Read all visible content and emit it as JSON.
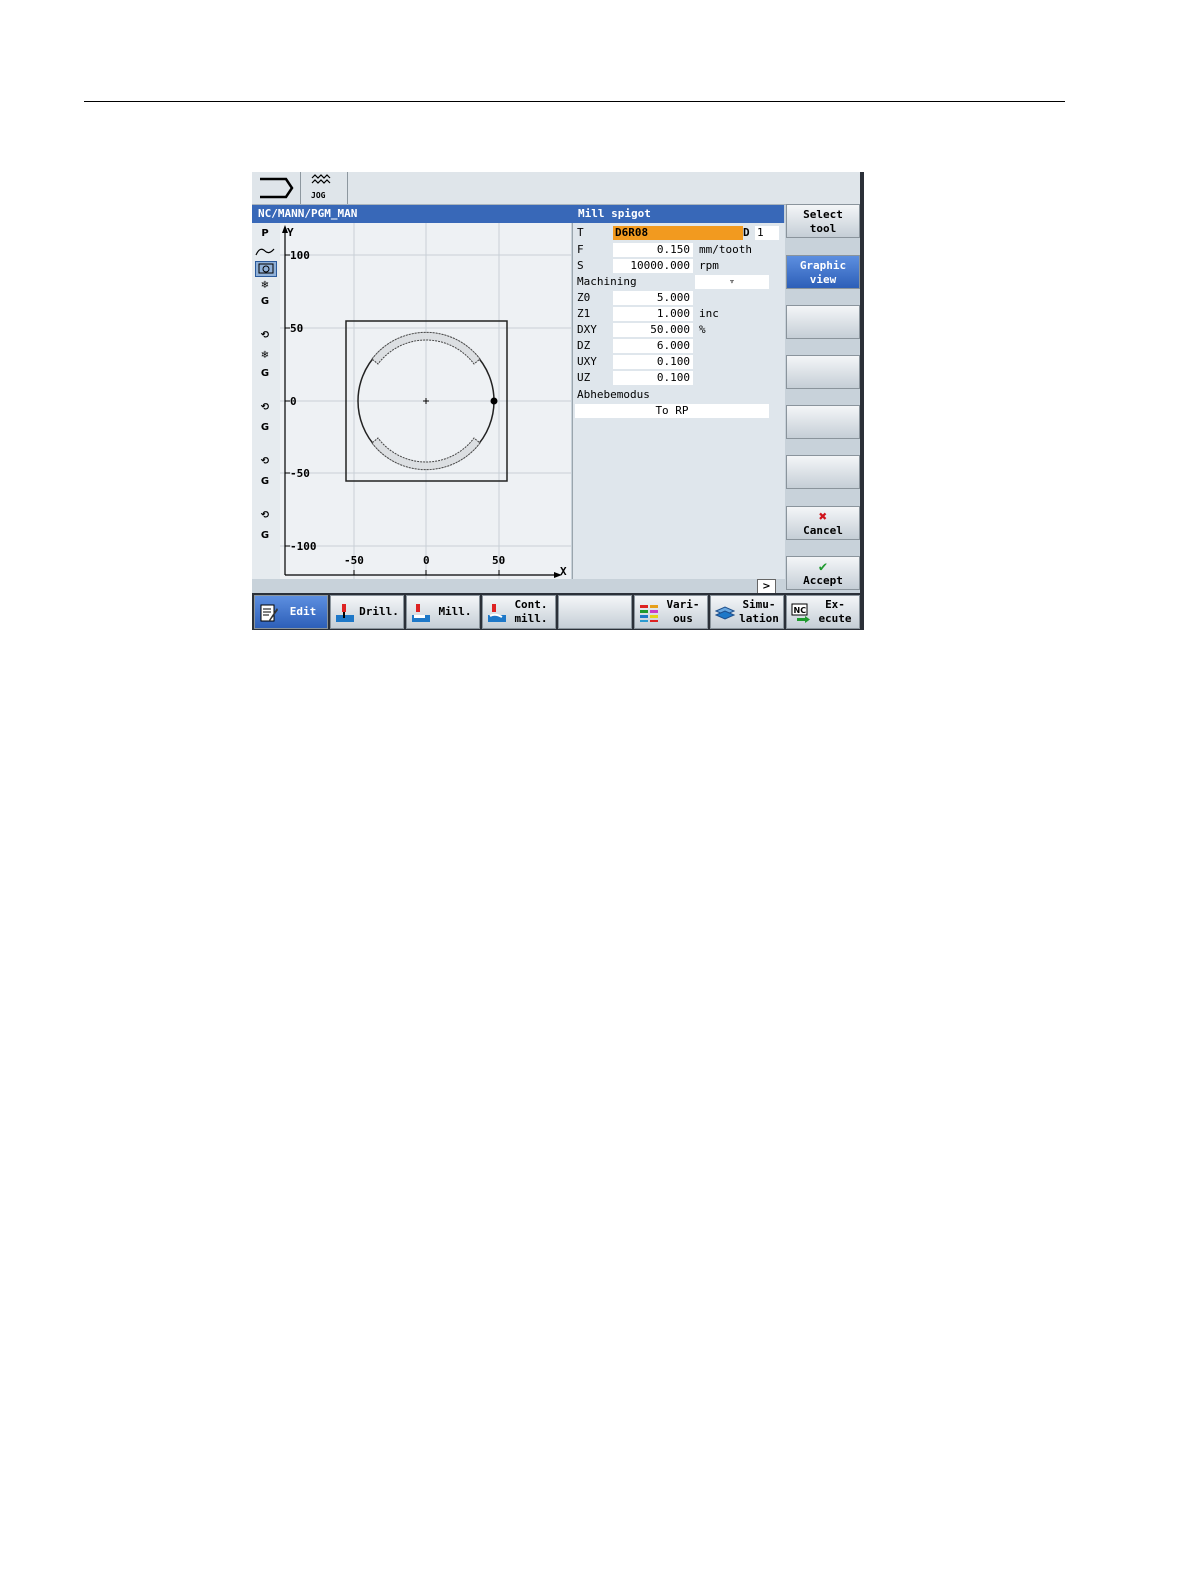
{
  "topbar": {
    "mode": "JOG"
  },
  "header": {
    "path": "NC/MANN/PGM_MAN",
    "cycle_title": "Mill spigot"
  },
  "left_icons": [
    "P",
    "G",
    "G",
    "G",
    "G",
    "G"
  ],
  "graph": {
    "y_axis_label": "Y",
    "x_axis_label": "X",
    "y_ticks": [
      "100",
      "50",
      "0",
      "-50",
      "-100"
    ],
    "x_ticks": [
      "-50",
      "0",
      "50"
    ]
  },
  "params": {
    "T": {
      "label": "T",
      "value": "D6R08",
      "d_label": "D",
      "d_value": "1"
    },
    "rows": [
      {
        "label": "F",
        "value": "0.150",
        "unit": "mm/tooth"
      },
      {
        "label": "S",
        "value": "10000.000",
        "unit": "rpm"
      }
    ],
    "machining": {
      "label": "Machining",
      "value": "▿"
    },
    "rows2": [
      {
        "label": "Z0",
        "value": "5.000",
        "unit": ""
      },
      {
        "label": "Z1",
        "value": "1.000",
        "unit": "inc"
      },
      {
        "label": "DXY",
        "value": "50.000",
        "unit": "%"
      },
      {
        "label": "DZ",
        "value": "6.000",
        "unit": ""
      },
      {
        "label": "UXY",
        "value": "0.100",
        "unit": ""
      },
      {
        "label": "UZ",
        "value": "0.100",
        "unit": ""
      }
    ],
    "retract": {
      "label": "Abhebemodus",
      "value": "To RP"
    },
    "more": ">"
  },
  "vertical_softkeys": [
    {
      "label": "Select\ntool"
    },
    {
      "label": "Graphic\nview"
    },
    {
      "label": ""
    },
    {
      "label": ""
    },
    {
      "label": ""
    },
    {
      "label": ""
    },
    {
      "label": "Cancel"
    },
    {
      "label": "Accept"
    }
  ],
  "bottom_softkeys": [
    {
      "label": "Edit"
    },
    {
      "label": "Drill."
    },
    {
      "label": "Mill."
    },
    {
      "label": "Cont.\nmill."
    },
    {
      "label": ""
    },
    {
      "label": "Vari-\nous"
    },
    {
      "label": "Simu-\nlation"
    },
    {
      "label": "Ex-\necute"
    }
  ],
  "icons": {
    "execute_icon_text": "NC"
  }
}
